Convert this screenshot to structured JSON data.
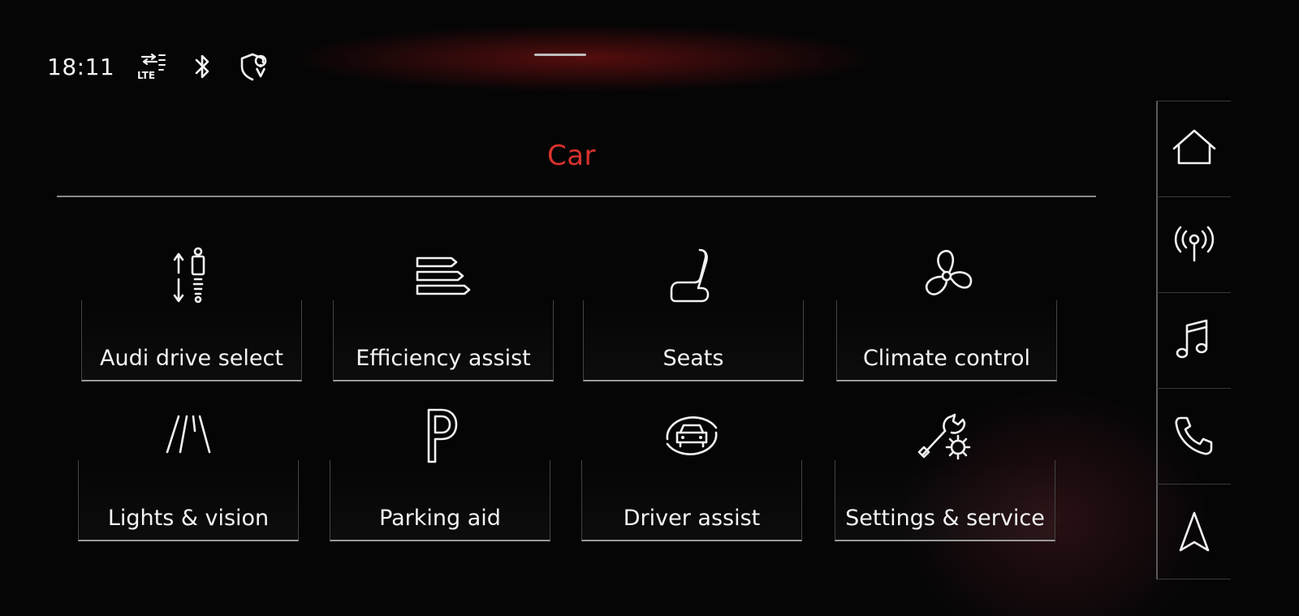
{
  "status_bar": {
    "time": "18:11",
    "network_label": "LTE",
    "icons": [
      "lte-data-icon",
      "bluetooth-icon",
      "location-shield-icon"
    ]
  },
  "header": {
    "title": "Car"
  },
  "tiles": [
    {
      "label": "Audi drive select",
      "icon": "suspension-icon"
    },
    {
      "label": "Efficiency assist",
      "icon": "efficiency-bars-icon"
    },
    {
      "label": "Seats",
      "icon": "seat-icon"
    },
    {
      "label": "Climate control",
      "icon": "fan-icon"
    },
    {
      "label": "Lights & vision",
      "icon": "lane-lights-icon"
    },
    {
      "label": "Parking aid",
      "icon": "parking-p-icon"
    },
    {
      "label": "Driver assist",
      "icon": "car-sensor-icon"
    },
    {
      "label": "Settings & service",
      "icon": "wrench-gear-icon"
    }
  ],
  "side_nav": [
    {
      "name": "home",
      "icon": "home-icon"
    },
    {
      "name": "radio",
      "icon": "radio-antenna-icon"
    },
    {
      "name": "media",
      "icon": "music-note-icon"
    },
    {
      "name": "phone",
      "icon": "phone-icon"
    },
    {
      "name": "navigation",
      "icon": "navigation-arrow-icon"
    }
  ],
  "colors": {
    "accent": "#d9322c",
    "text": "#f4f4f4",
    "background": "#050506",
    "divider": "#9a9a9a"
  }
}
